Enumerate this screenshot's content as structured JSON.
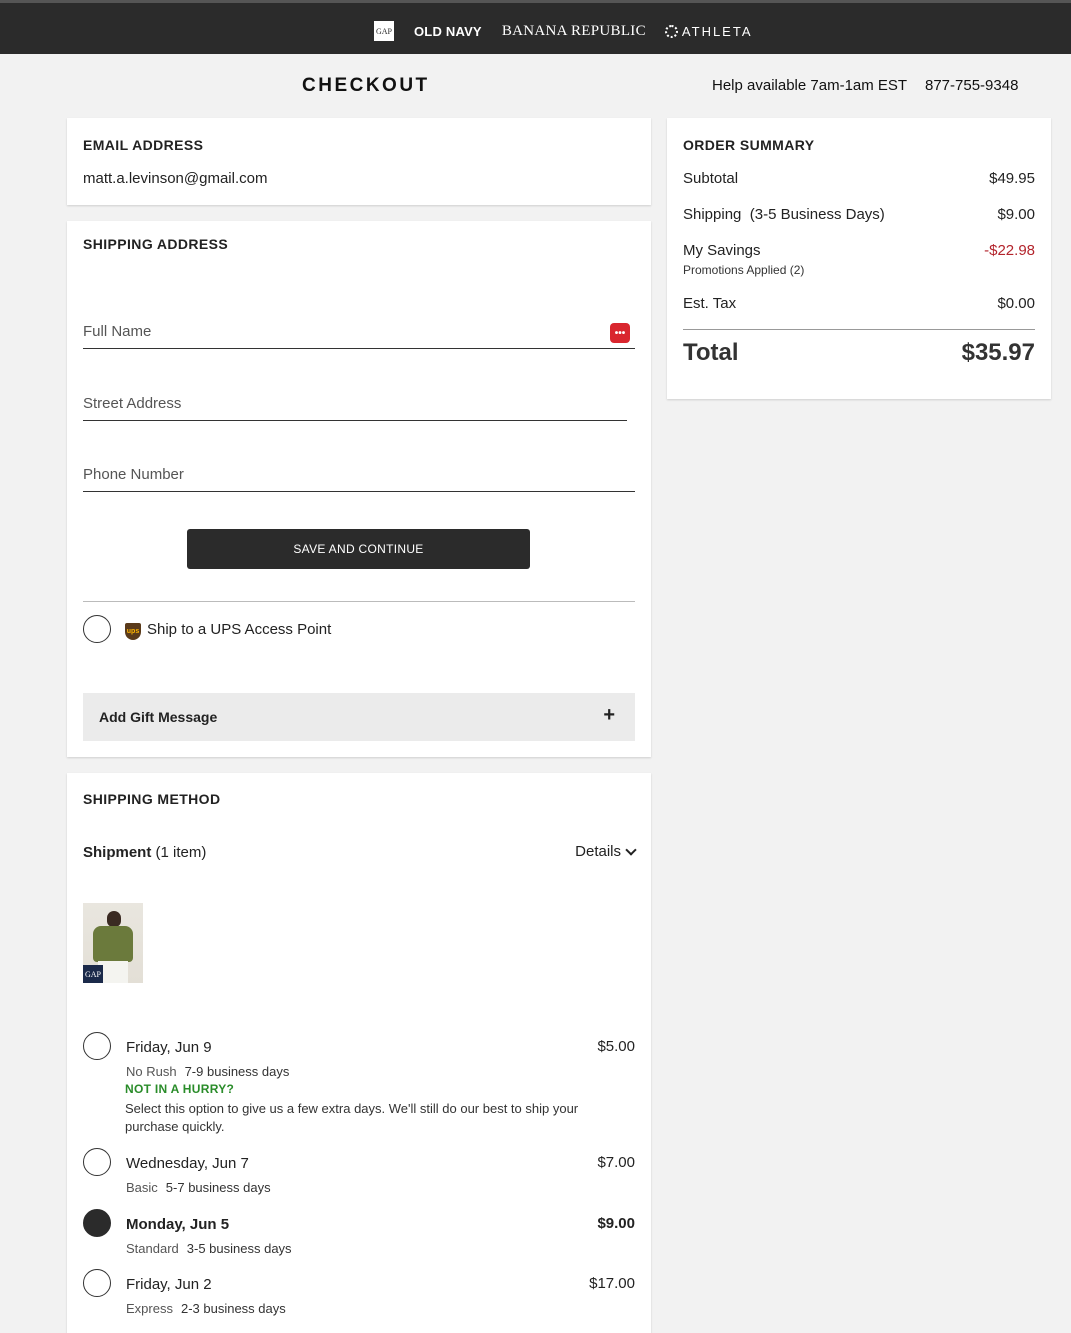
{
  "brands": {
    "gap": "GAP",
    "old_navy": "OLD NAVY",
    "banana_republic": "BANANA REPUBLIC",
    "athleta": "ATHLETA"
  },
  "header": {
    "title": "CHECKOUT",
    "help_text": "Help available 7am-1am EST",
    "phone": "877-755-9348"
  },
  "email": {
    "title": "EMAIL ADDRESS",
    "value": "matt.a.levinson@gmail.com"
  },
  "shipping_address": {
    "title": "SHIPPING ADDRESS",
    "full_name_placeholder": "Full Name",
    "street_placeholder": "Street Address",
    "phone_placeholder": "Phone Number",
    "save_label": "SAVE AND CONTINUE",
    "ups_label": "Ship to a UPS Access Point",
    "ups_logo_text": "ups",
    "gift_label": "Add Gift Message",
    "gift_plus": "+"
  },
  "shipping_method": {
    "title": "SHIPPING METHOD",
    "shipment_label": "Shipment",
    "shipment_count": "(1 item)",
    "details_label": "Details",
    "product_badge": "GAP",
    "options": [
      {
        "date": "Friday, Jun 9",
        "type": "No Rush",
        "days": "7-9 business days",
        "price": "$5.00",
        "selected": false,
        "promo_title": "NOT IN A HURRY?",
        "promo_desc": "Select this option to give us a few extra days. We'll still do our best to ship your purchase quickly."
      },
      {
        "date": "Wednesday, Jun 7",
        "type": "Basic",
        "days": "5-7 business days",
        "price": "$7.00",
        "selected": false
      },
      {
        "date": "Monday, Jun 5",
        "type": "Standard",
        "days": "3-5 business days",
        "price": "$9.00",
        "selected": true
      },
      {
        "date": "Friday, Jun 2",
        "type": "Express",
        "days": "2-3 business days",
        "price": "$17.00",
        "selected": false
      }
    ]
  },
  "order_summary": {
    "title": "ORDER SUMMARY",
    "subtotal_label": "Subtotal",
    "subtotal": "$49.95",
    "shipping_label": "Shipping",
    "shipping_note": "(3-5 Business Days)",
    "shipping": "$9.00",
    "savings_label": "My Savings",
    "savings_sub": "Promotions Applied (2)",
    "savings": "-$22.98",
    "tax_label": "Est. Tax",
    "tax": "$0.00",
    "total_label": "Total",
    "total": "$35.97"
  },
  "colors": {
    "dark": "#2b2b2b",
    "savings_red": "#b3242c",
    "promo_green": "#2a8c2a"
  }
}
